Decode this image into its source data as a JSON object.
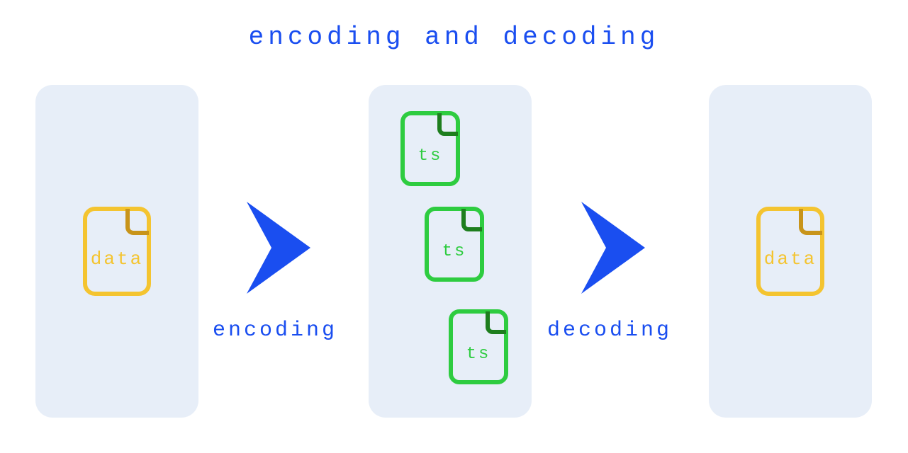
{
  "title": "encoding and decoding",
  "left": {
    "file_label": "data"
  },
  "mid": {
    "file_label": "ts"
  },
  "right": {
    "file_label": "data"
  },
  "arrows": {
    "encoding_label": "encoding",
    "decoding_label": "decoding"
  },
  "colors": {
    "blue": "#1a4ef0",
    "panel_bg": "#e7eef8",
    "yellow_light": "#f4c430",
    "yellow_dark": "#c8941a",
    "green_light": "#2ecc40",
    "green_dark": "#1e7e1e"
  }
}
